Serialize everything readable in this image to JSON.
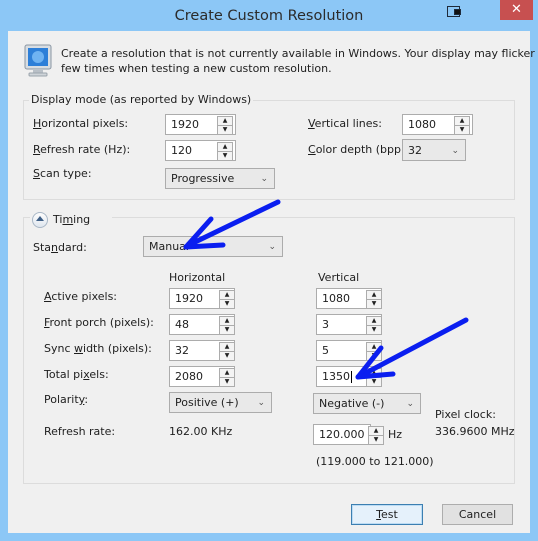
{
  "window": {
    "title": "Create Custom Resolution",
    "close_label": "✕"
  },
  "intro": {
    "icon": "monitor-icon",
    "text_line1": "Create a resolution that is not currently available in Windows. Your display may flicker a",
    "text_line2": "few times when testing a new custom resolution."
  },
  "display_mode": {
    "group_label": "Display mode (as reported by Windows)",
    "horizontal_pixels": {
      "label_u": "H",
      "label_rest": "orizontal pixels:",
      "value": "1920"
    },
    "vertical_lines": {
      "label_u": "V",
      "label_rest": "ertical lines:",
      "value": "1080"
    },
    "refresh_rate": {
      "label_u": "R",
      "label_rest": "efresh rate (Hz):",
      "value": "120"
    },
    "color_depth": {
      "label_u": "C",
      "label_rest": "olor depth (bpp):",
      "value": "32"
    },
    "scan_type": {
      "label_u": "S",
      "label_rest": "can type:",
      "value": "Progressive"
    }
  },
  "timing": {
    "group_label_pre": "Ti",
    "group_label_u": "m",
    "group_label_post": "ing",
    "standard": {
      "label_pre": "Sta",
      "label_u": "n",
      "label_post": "dard:",
      "value": "Manual"
    },
    "col_horizontal": "Horizontal",
    "col_vertical": "Vertical",
    "rows": [
      {
        "label_pre": "",
        "label_u": "A",
        "label_post": "ctive pixels:",
        "h": "1920",
        "v": "1080"
      },
      {
        "label_pre": "",
        "label_u": "F",
        "label_post": "ront porch (pixels):",
        "h": "48",
        "v": "3"
      },
      {
        "label_pre": "Sync ",
        "label_u": "w",
        "label_post": "idth (pixels):",
        "h": "32",
        "v": "5"
      },
      {
        "label_pre": "Total pi",
        "label_u": "x",
        "label_post": "els:",
        "h": "2080",
        "v": "1350"
      }
    ],
    "polarity": {
      "label_pre": "Polarit",
      "label_u": "y",
      "label_post": ":",
      "h": "Positive (+)",
      "v": "Negative (-)"
    },
    "refresh_rate": {
      "label": "Refresh rate:",
      "h_value": "162.00 KHz",
      "v_value": "120.000",
      "v_unit": "Hz",
      "range": "(119.000 to 121.000)"
    },
    "pixel_clock": {
      "label": "Pixel clock:",
      "value": "336.9600 MHz"
    }
  },
  "buttons": {
    "test_u": "T",
    "test_rest": "est",
    "cancel": "Cancel"
  },
  "annotations": {
    "arrow_color": "#0a1ef0"
  }
}
